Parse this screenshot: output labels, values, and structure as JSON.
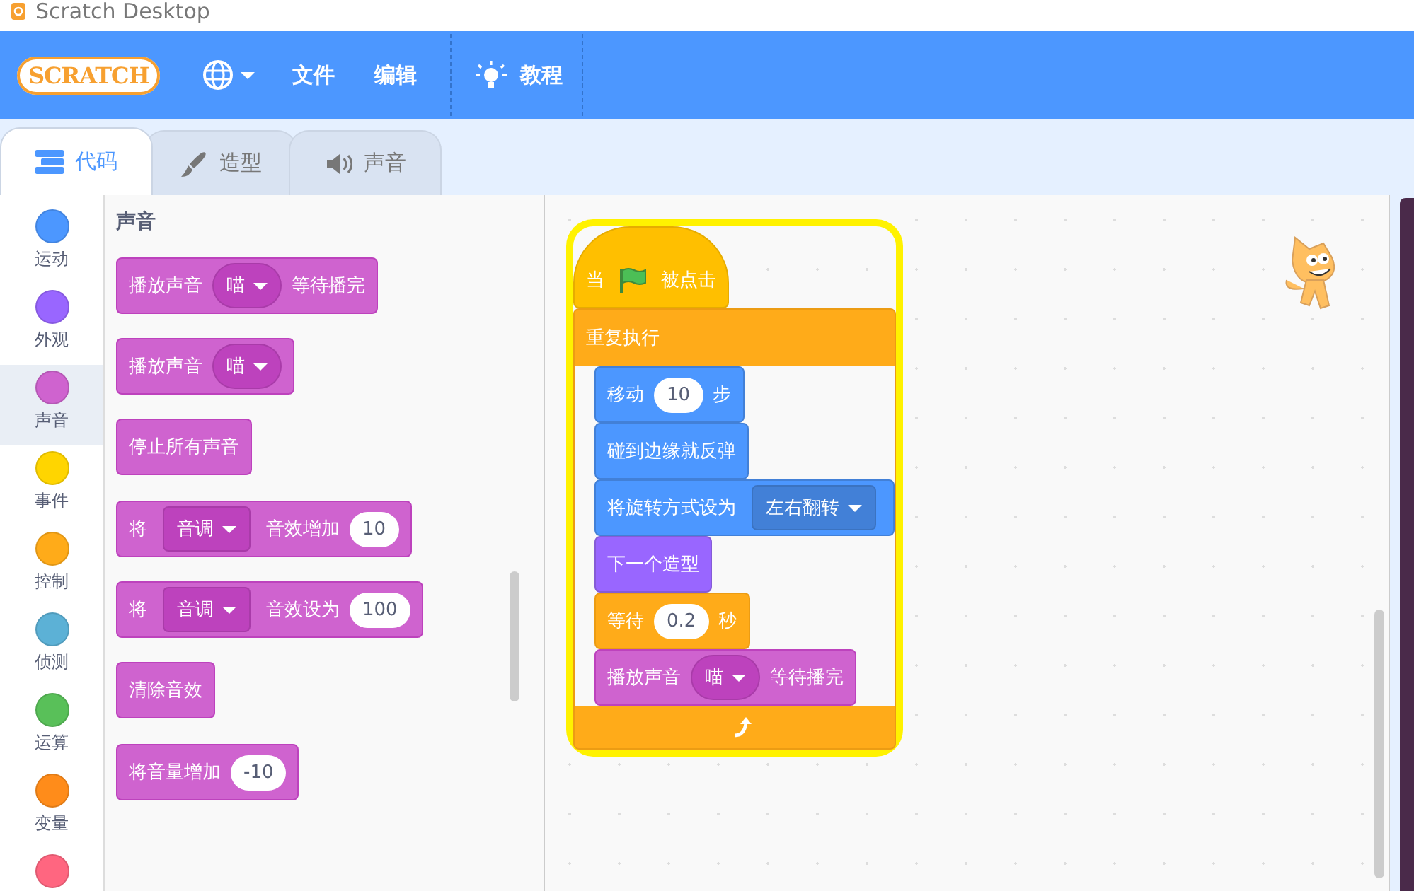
{
  "window": {
    "title": "Scratch Desktop"
  },
  "menu_bar": {
    "logo": "SCRATCH",
    "items": [
      {
        "kind": "language"
      },
      {
        "kind": "text",
        "label": "文件"
      },
      {
        "kind": "text",
        "label": "编辑"
      },
      {
        "kind": "tutorial",
        "label": "教程"
      }
    ]
  },
  "tabs": [
    {
      "label": "代码",
      "kind": "code",
      "selected": true
    },
    {
      "label": "造型",
      "kind": "costume",
      "selected": false
    },
    {
      "label": "声音",
      "kind": "sound",
      "selected": false
    }
  ],
  "categories": [
    {
      "label": "运动",
      "color": "#4c97ff",
      "selected": false
    },
    {
      "label": "外观",
      "color": "#9966ff",
      "selected": false
    },
    {
      "label": "声音",
      "color": "#cf63cf",
      "selected": true
    },
    {
      "label": "事件",
      "color": "#ffd500",
      "selected": false
    },
    {
      "label": "控制",
      "color": "#ffab19",
      "selected": false
    },
    {
      "label": "侦测",
      "color": "#5cb1d6",
      "selected": false
    },
    {
      "label": "运算",
      "color": "#59c059",
      "selected": false
    },
    {
      "label": "变量",
      "color": "#ff8c1a",
      "selected": false
    },
    {
      "color": "#ff6680",
      "selected": false
    }
  ],
  "palette": {
    "heading": "声音",
    "groups": [
      [
        {
          "kind": "sound",
          "parts": [
            {
              "kind": "text",
              "text": "播放声音"
            },
            {
              "kind": "menu",
              "text": "喵"
            },
            {
              "kind": "text",
              "text": "等待播完"
            }
          ]
        },
        {
          "kind": "sound",
          "parts": [
            {
              "kind": "text",
              "text": "播放声音"
            },
            {
              "kind": "menu",
              "text": "喵"
            }
          ]
        },
        {
          "kind": "sound",
          "parts": [
            {
              "kind": "text",
              "text": "停止所有声音"
            }
          ]
        }
      ],
      [
        {
          "kind": "sound",
          "parts": [
            {
              "kind": "text",
              "text": "将"
            },
            {
              "kind": "dropdown",
              "text": "音调"
            },
            {
              "kind": "text",
              "text": "音效增加"
            },
            {
              "kind": "number",
              "text": "10"
            }
          ]
        },
        {
          "kind": "sound",
          "parts": [
            {
              "kind": "text",
              "text": "将"
            },
            {
              "kind": "dropdown",
              "text": "音调"
            },
            {
              "kind": "text",
              "text": "音效设为"
            },
            {
              "kind": "number",
              "text": "100"
            }
          ]
        },
        {
          "kind": "sound",
          "parts": [
            {
              "kind": "text",
              "text": "清除音效"
            }
          ]
        }
      ],
      [
        {
          "kind": "sound",
          "parts": [
            {
              "kind": "text",
              "text": "将音量增加"
            },
            {
              "kind": "number",
              "text": "-10"
            }
          ]
        }
      ]
    ]
  },
  "script": {
    "glowing": true,
    "hat_block": {
      "kind": "events",
      "parts": [
        {
          "kind": "text",
          "text": "当"
        },
        {
          "kind": "flag"
        },
        {
          "kind": "text",
          "text": "被点击"
        }
      ]
    },
    "forever_block": {
      "kind": "control",
      "parts": [
        {
          "kind": "text",
          "text": "重复执行"
        }
      ],
      "children": [
        {
          "kind": "motion",
          "parts": [
            {
              "kind": "text",
              "text": "移动"
            },
            {
              "kind": "number",
              "text": "10"
            },
            {
              "kind": "text",
              "text": "步"
            }
          ]
        },
        {
          "kind": "motion",
          "parts": [
            {
              "kind": "text",
              "text": "碰到边缘就反弹"
            }
          ]
        },
        {
          "kind": "motion",
          "parts": [
            {
              "kind": "text",
              "text": "将旋转方式设为"
            },
            {
              "kind": "dropdown",
              "text": "左右翻转"
            }
          ]
        },
        {
          "kind": "looks",
          "parts": [
            {
              "kind": "text",
              "text": "下一个造型"
            }
          ]
        },
        {
          "kind": "control",
          "parts": [
            {
              "kind": "text",
              "text": "等待"
            },
            {
              "kind": "number",
              "text": "0.2"
            },
            {
              "kind": "text",
              "text": "秒"
            }
          ]
        },
        {
          "kind": "sound",
          "parts": [
            {
              "kind": "text",
              "text": "播放声音"
            },
            {
              "kind": "menu",
              "text": "喵"
            },
            {
              "kind": "text",
              "text": "等待播完"
            }
          ]
        }
      ]
    }
  }
}
